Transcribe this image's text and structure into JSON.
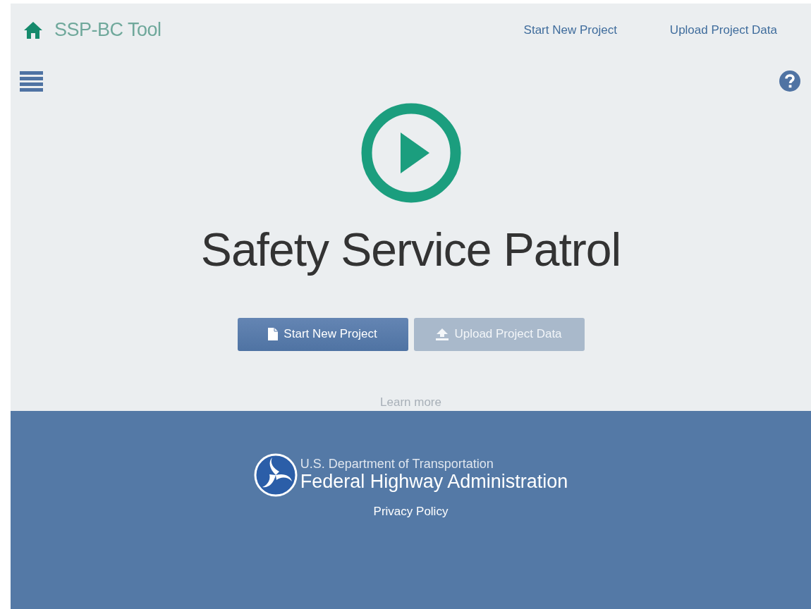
{
  "header": {
    "title": "SSP-BC Tool",
    "nav_links": [
      "Start New Project",
      "Upload Project Data"
    ]
  },
  "hero": {
    "title": "Safety Service Patrol",
    "buttons": [
      {
        "label": "Start New Project",
        "kind": "file",
        "disabled": false
      },
      {
        "label": "Upload Project Data",
        "kind": "upload",
        "disabled": true
      }
    ],
    "link": "Learn more"
  },
  "footer": {
    "agency_line1": "U.S. Department of Transportation",
    "agency_line2": "Federal Highway Administration",
    "link": "Privacy Policy"
  }
}
